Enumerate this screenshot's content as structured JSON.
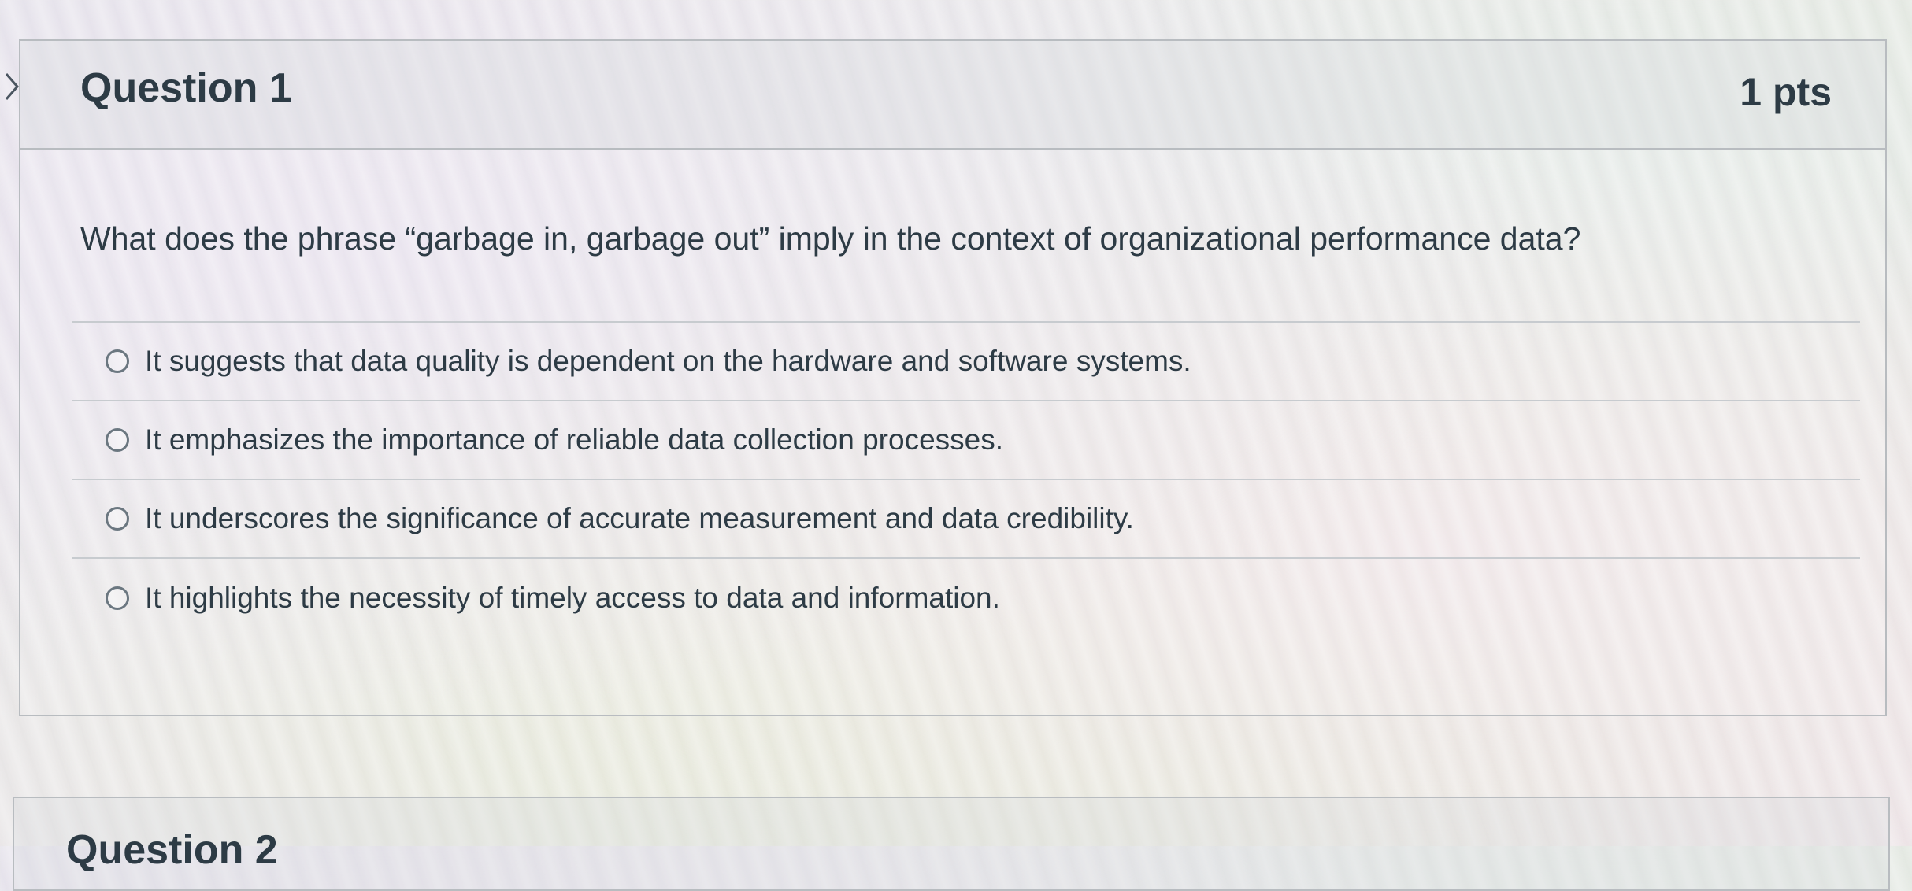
{
  "question": {
    "title": "Question 1",
    "points": "1 pts",
    "text": "What does the phrase “garbage in, garbage out” imply in the context of organizational performance data?",
    "answers": [
      {
        "label": "It suggests that data quality is dependent on the hardware and software systems.",
        "selected": false
      },
      {
        "label": "It emphasizes the importance of reliable data collection processes.",
        "selected": false
      },
      {
        "label": "It underscores the significance of accurate measurement and data credibility.",
        "selected": false
      },
      {
        "label": "It highlights the necessity of timely access to data and information.",
        "selected": false
      }
    ]
  },
  "next_question": {
    "title": "Question 2"
  },
  "icons": {
    "collapse": "chevron-right-icon",
    "radio": "radio-unchecked-icon"
  },
  "colors": {
    "text": "#2d3b45",
    "border": "#b8bcc0",
    "radio_border": "#6b7780"
  }
}
